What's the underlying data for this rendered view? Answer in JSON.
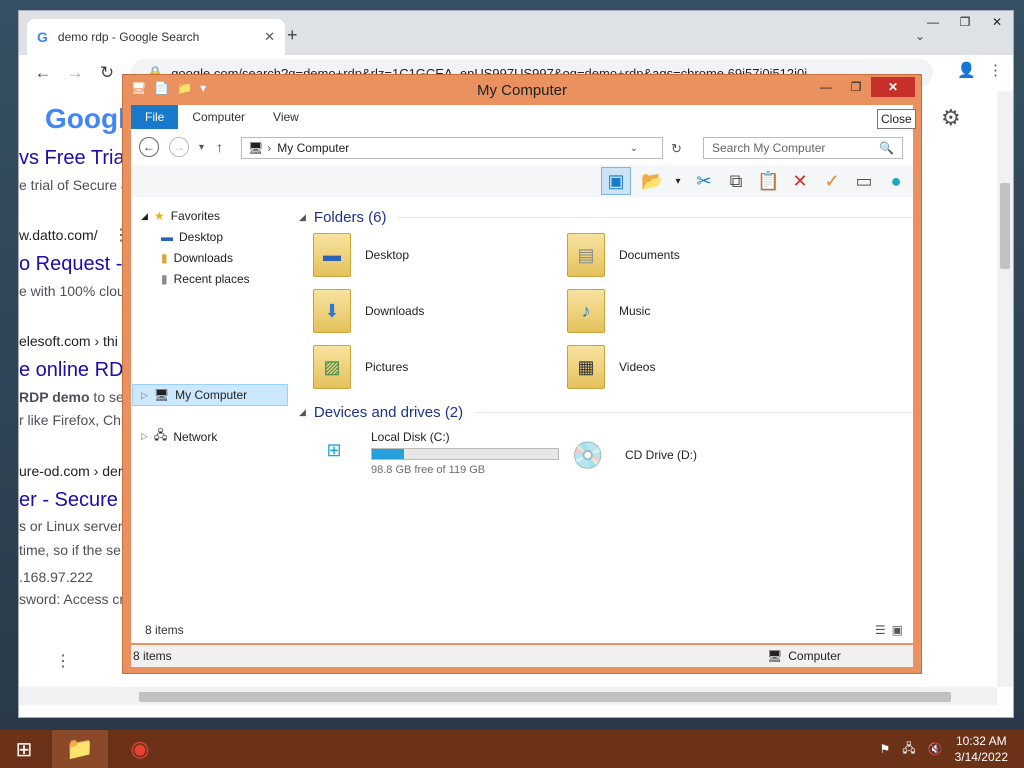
{
  "chrome": {
    "tab_title": "demo rdp - Google Search",
    "tab_icon": "google-g-icon",
    "url": "google.com/search?q=demo+rdp&rlz=1C1GCEA_enUS997US997&oq=demo+rdp&aqs=chrome.69i57j0i512j0i",
    "page": {
      "logo": "Google",
      "results": [
        {
          "title": "vs Free Trial",
          "snippet": "e trial of Secure &"
        },
        {
          "cite": "w.datto.com/"
        },
        {
          "title": "o Request -",
          "snippet": "e with 100% clou"
        },
        {
          "cite": "elesoft.com › thi"
        },
        {
          "title": "e online RDP",
          "snippet_bold": "RDP demo",
          "snippet": " to se",
          "snippet2": "r like Firefox, Chr"
        },
        {
          "cite": "ure-od.com › der"
        },
        {
          "title": "er - Secure",
          "snippet": "s or Linux server",
          "snippet2": "time, so if the se",
          "snippet3": ".168.97.222",
          "snippet4": "sword: Access cre"
        }
      ]
    }
  },
  "explorer": {
    "title": "My Computer",
    "tooltip": "Close",
    "ribbon_tabs": [
      "File",
      "Computer",
      "View"
    ],
    "address": "My Computer",
    "search_placeholder": "Search My Computer",
    "nav": {
      "favorites": "Favorites",
      "fav_items": [
        "Desktop",
        "Downloads",
        "Recent places"
      ],
      "my_computer": "My Computer",
      "network": "Network"
    },
    "folders_header": "Folders (6)",
    "folders": [
      "Desktop",
      "Documents",
      "Downloads",
      "Music",
      "Pictures",
      "Videos"
    ],
    "devices_header": "Devices and drives (2)",
    "drive_c": {
      "name": "Local Disk (C:)",
      "free_text": "98.8 GB free of 119 GB",
      "used_fraction": 0.17
    },
    "drive_d": {
      "name": "CD Drive (D:)"
    },
    "item_count": "8 items",
    "status_count": "8 items",
    "status_location": "Computer"
  },
  "taskbar": {
    "time": "10:32 AM",
    "date": "3/14/2022"
  }
}
